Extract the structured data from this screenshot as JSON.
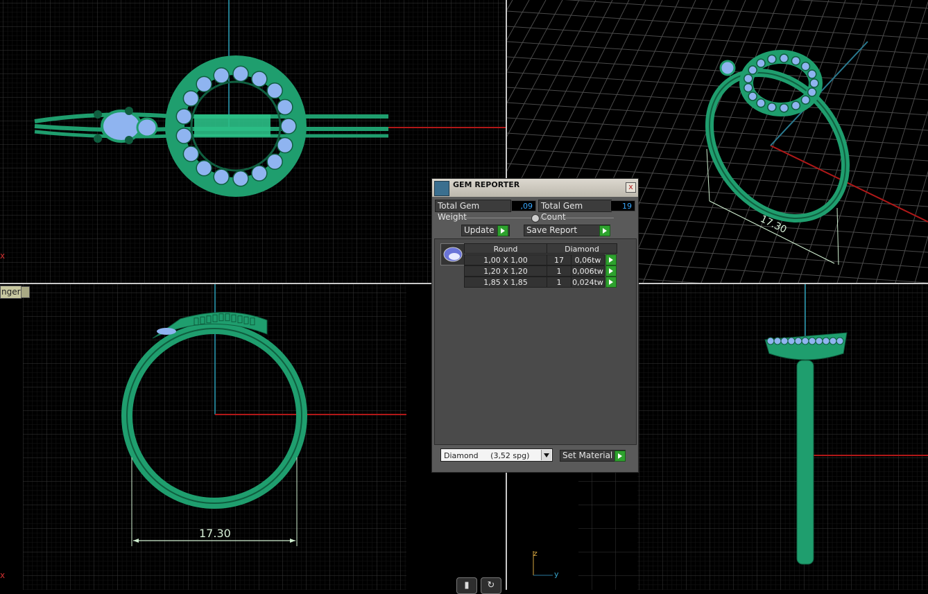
{
  "gem_reporter": {
    "title": "GEM REPORTER",
    "close_glyph": "x",
    "total_weight_label": "Total Gem Weight",
    "total_weight_value": ",09",
    "total_count_label": "Total Gem Count",
    "total_count_value": "19",
    "update_label": "Update",
    "save_report_label": "Save Report",
    "table": {
      "headers": [
        "Round",
        "Diamond"
      ],
      "rows": [
        {
          "size": "1,00 X 1,00",
          "count": "17",
          "weight": "0,06tw"
        },
        {
          "size": "1,20 X 1,20",
          "count": "1",
          "weight": "0,006tw"
        },
        {
          "size": "1,85 X 1,85",
          "count": "1",
          "weight": "0,024tw"
        }
      ]
    },
    "material_select": "Diamond     (3,52 spg)",
    "set_material_label": "Set Material"
  },
  "viewports": {
    "perspective_dimension": "17.30",
    "front_dimension": "17.30",
    "view_tag": "nger",
    "axis_z": "z",
    "axis_y": "y"
  },
  "colors": {
    "ring": "#1f9e6e",
    "ring_dark": "#0f5e3f",
    "gem": "#8fb4f0",
    "grid": "#3a3a3a",
    "axis_red": "#b01818",
    "axis_cyan": "#2aa0b8",
    "dimension": "#cfeecf"
  }
}
